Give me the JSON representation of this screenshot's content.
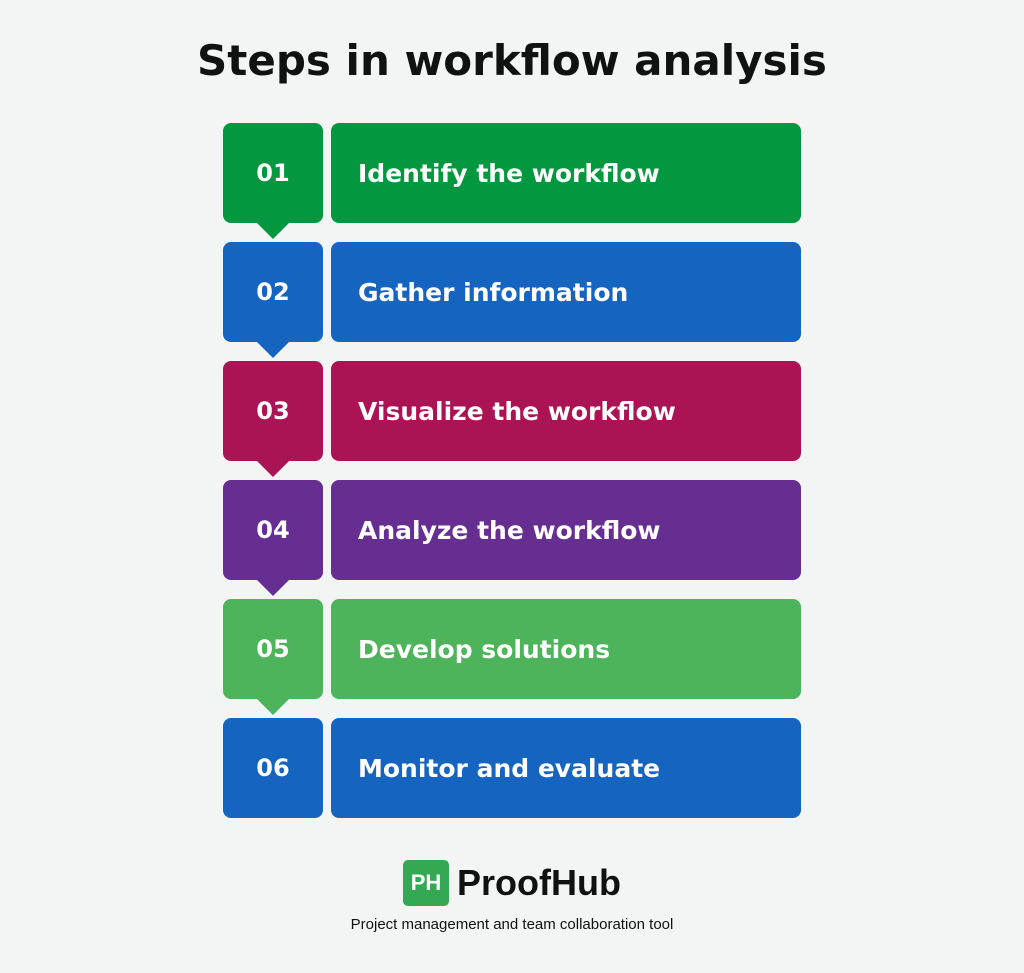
{
  "title": "Steps in workflow analysis",
  "steps": [
    {
      "number": "01",
      "label": "Identify the workflow",
      "color": "#03983f"
    },
    {
      "number": "02",
      "label": "Gather information",
      "color": "#1565c0"
    },
    {
      "number": "03",
      "label": "Visualize the workflow",
      "color": "#ab1454"
    },
    {
      "number": "04",
      "label": "Analyze the workflow",
      "color": "#672e92"
    },
    {
      "number": "05",
      "label": "Develop solutions",
      "color": "#4db45b"
    },
    {
      "number": "06",
      "label": "Monitor and evaluate",
      "color": "#1565c0"
    }
  ],
  "brand": {
    "logo_text": "PH",
    "name": "ProofHub",
    "tagline": "Project management and team collaboration tool",
    "logo_color": "#34a853"
  }
}
